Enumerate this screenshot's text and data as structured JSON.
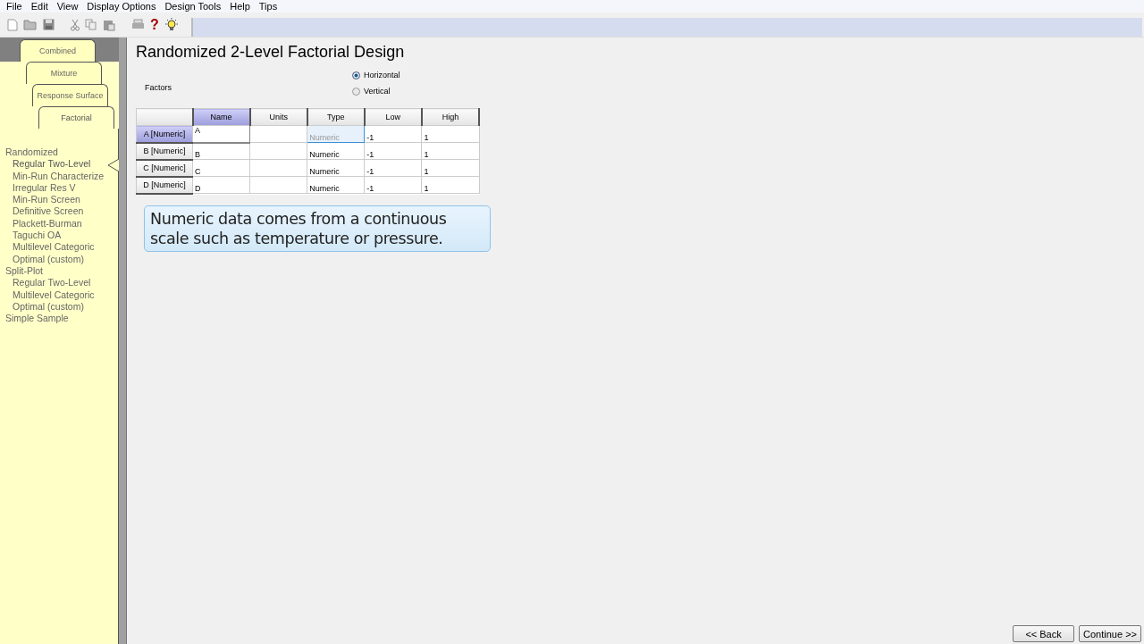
{
  "menu": [
    "File",
    "Edit",
    "View",
    "Display Options",
    "Design Tools",
    "Help",
    "Tips"
  ],
  "help_glyph": "?",
  "tabs": [
    {
      "label": "Combined",
      "selected": false
    },
    {
      "label": "Mixture",
      "selected": false
    },
    {
      "label": "Response Surface",
      "selected": false
    },
    {
      "label": "Factorial",
      "selected": true
    }
  ],
  "design_tree": [
    {
      "label": "Randomized",
      "selected": false,
      "children": [
        {
          "label": "Regular Two-Level",
          "selected": true
        },
        {
          "label": "Min-Run Characterize",
          "selected": false
        },
        {
          "label": "Irregular Res V",
          "selected": false
        },
        {
          "label": "Min-Run Screen",
          "selected": false
        },
        {
          "label": "Definitive Screen",
          "selected": false
        },
        {
          "label": "Plackett-Burman",
          "selected": false
        },
        {
          "label": "Taguchi OA",
          "selected": false
        },
        {
          "label": "Multilevel Categoric",
          "selected": false
        },
        {
          "label": "Optimal (custom)",
          "selected": false
        }
      ]
    },
    {
      "label": "Split-Plot",
      "selected": false,
      "children": [
        {
          "label": "Regular Two-Level",
          "selected": false
        },
        {
          "label": "Multilevel Categoric",
          "selected": false
        },
        {
          "label": "Optimal (custom)",
          "selected": false
        }
      ]
    },
    {
      "label": "Simple Sample",
      "selected": false
    }
  ],
  "title": "Randomized 2-Level Factorial Design",
  "factors_label": "Factors",
  "orientation": [
    {
      "label": "Horizontal",
      "selected": true
    },
    {
      "label": "Vertical",
      "selected": false
    }
  ],
  "table": {
    "columns": [
      {
        "label": "Name",
        "selected": true
      },
      {
        "label": "Units",
        "selected": false
      },
      {
        "label": "Type",
        "selected": false
      },
      {
        "label": "Low",
        "selected": false
      },
      {
        "label": "High",
        "selected": false
      }
    ],
    "rows": [
      {
        "header": "A [Numeric]",
        "selected": true,
        "cells": [
          {
            "text": "A",
            "focused": false
          },
          {
            "text": "",
            "focused": false
          },
          {
            "text": "Numeric",
            "focused": true
          },
          {
            "text": "-1",
            "focused": false
          },
          {
            "text": "1",
            "focused": false
          }
        ]
      },
      {
        "header": "B [Numeric]",
        "selected": false,
        "cells": [
          {
            "text": "B",
            "focused": false
          },
          {
            "text": "",
            "focused": false
          },
          {
            "text": "Numeric",
            "focused": false
          },
          {
            "text": "-1",
            "focused": false
          },
          {
            "text": "1",
            "focused": false
          }
        ]
      },
      {
        "header": "C [Numeric]",
        "selected": false,
        "cells": [
          {
            "text": "C",
            "focused": false
          },
          {
            "text": "",
            "focused": false
          },
          {
            "text": "Numeric",
            "focused": false
          },
          {
            "text": "-1",
            "focused": false
          },
          {
            "text": "1",
            "focused": false
          }
        ]
      },
      {
        "header": "D [Numeric]",
        "selected": false,
        "cells": [
          {
            "text": "D",
            "focused": false
          },
          {
            "text": "",
            "focused": false
          },
          {
            "text": "Numeric",
            "focused": false
          },
          {
            "text": "-1",
            "focused": false
          },
          {
            "text": "1",
            "focused": false
          }
        ]
      }
    ]
  },
  "hint": "Numeric data comes from a continuous scale such as temperature or pressure.",
  "buttons": [
    "<< Back",
    "Continue >>"
  ]
}
